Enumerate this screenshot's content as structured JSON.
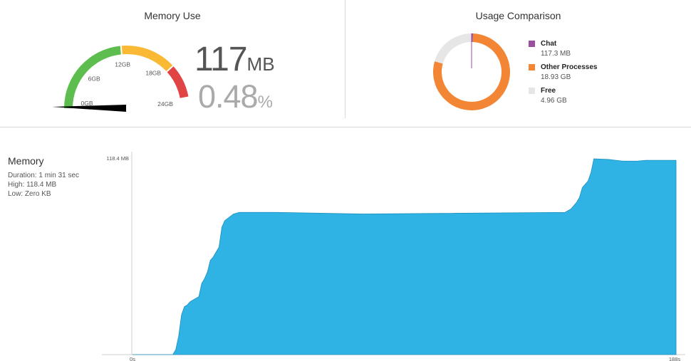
{
  "memory_use": {
    "title": "Memory Use",
    "value": "117",
    "unit": "MB",
    "percent": "0.48",
    "percent_unit": "%",
    "gauge": {
      "labels": [
        "0GB",
        "6GB",
        "12GB",
        "18GB",
        "24GB"
      ],
      "max_gb": 24,
      "needle_gb": 0.117,
      "colors": {
        "green": "#5dbd4e",
        "yellow": "#f9b935",
        "red": "#e04444"
      }
    }
  },
  "usage_comparison": {
    "title": "Usage Comparison",
    "items": [
      {
        "name": "Chat",
        "value": "117.3 MB",
        "gb": 0.117,
        "color": "#9b4f9f"
      },
      {
        "name": "Other Processes",
        "value": "18.93 GB",
        "gb": 18.93,
        "color": "#f28634"
      },
      {
        "name": "Free",
        "value": "4.96 GB",
        "gb": 4.96,
        "color": "#e6e6e6"
      }
    ]
  },
  "memory_graph": {
    "title": "Memory",
    "duration": "Duration: 1 min 31 sec",
    "high": "High: 118.4 MB",
    "low": "Low: Zero KB",
    "y_max_label": "118.4 MB",
    "x_start_label": "0s",
    "x_end_label": "188s",
    "color": "#2fb3e4"
  },
  "chart_data": {
    "type": "area",
    "title": "Memory",
    "xlabel": "",
    "ylabel": "",
    "xlim": [
      0,
      188
    ],
    "ylim": [
      0,
      118.4
    ],
    "x": [
      0,
      14,
      15,
      16,
      17,
      18,
      19,
      20,
      21,
      22,
      23,
      24,
      25,
      26,
      27,
      28,
      29,
      30,
      31,
      32,
      35,
      37,
      40,
      50,
      80,
      150,
      151,
      152,
      153,
      154,
      155,
      156,
      157,
      158,
      159,
      160,
      165,
      170,
      175,
      178,
      188.5
    ],
    "series": [
      {
        "values": [
          0,
          0,
          3,
          11,
          24,
          29,
          30,
          32,
          33,
          34,
          35,
          43,
          46,
          50,
          57,
          59,
          62,
          65,
          77,
          81,
          85,
          86,
          86,
          86,
          85,
          86,
          87,
          88,
          90,
          92,
          95,
          101,
          103,
          105,
          110,
          118.4,
          118,
          117,
          117,
          117.5,
          117.5
        ]
      }
    ]
  }
}
